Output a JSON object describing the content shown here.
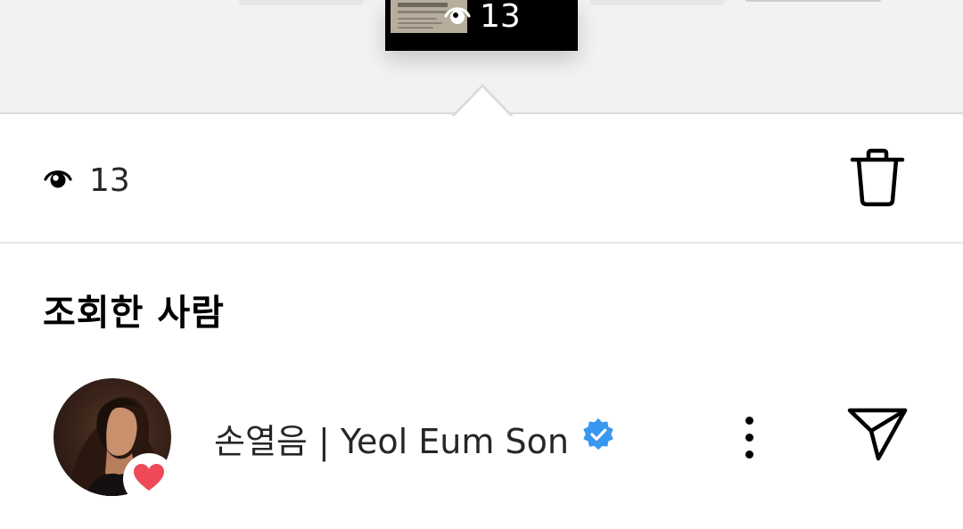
{
  "story_strip": {
    "thumbnail_view_count": "13",
    "thumbnail_icon": "eye-icon"
  },
  "stats": {
    "view_count": "13",
    "view_icon": "eye-icon",
    "delete_icon": "trash-icon"
  },
  "viewers_section": {
    "title": "조회한 사람",
    "viewers": [
      {
        "name": "손열음 | Yeol Eum Son",
        "verified": true,
        "reaction": "heart-icon",
        "more_icon": "more-vertical-icon",
        "send_icon": "send-icon"
      }
    ]
  },
  "colors": {
    "verified_badge": "#3897f0",
    "heart": "#ed4956",
    "text_primary": "#262626",
    "strip_background": "#f2f2f2"
  }
}
